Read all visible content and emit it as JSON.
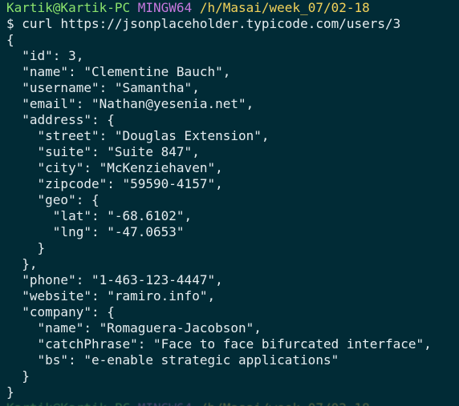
{
  "prompt": {
    "user_host": "Kartik@Kartik-PC",
    "shell": "MINGW64",
    "path": "/h/Masai/week_07/02-18",
    "dollar": "$"
  },
  "command": "curl https://jsonplaceholder.typicode.com/users/3",
  "output_lines": [
    "{",
    "  \"id\": 3,",
    "  \"name\": \"Clementine Bauch\",",
    "  \"username\": \"Samantha\",",
    "  \"email\": \"Nathan@yesenia.net\",",
    "  \"address\": {",
    "    \"street\": \"Douglas Extension\",",
    "    \"suite\": \"Suite 847\",",
    "    \"city\": \"McKenziehaven\",",
    "    \"zipcode\": \"59590-4157\",",
    "    \"geo\": {",
    "      \"lat\": \"-68.6102\",",
    "      \"lng\": \"-47.0653\"",
    "    }",
    "  },",
    "  \"phone\": \"1-463-123-4447\",",
    "  \"website\": \"ramiro.info\",",
    "  \"company\": {",
    "    \"name\": \"Romaguera-Jacobson\",",
    "    \"catchPhrase\": \"Face to face bifurcated interface\",",
    "    \"bs\": \"e-enable strategic applications\"",
    "  }",
    "}"
  ],
  "colors": {
    "background": "#012b36",
    "user_host": "#8be36d",
    "shell": "#c678dd",
    "path": "#f2d25a",
    "text": "#e6edf0"
  }
}
